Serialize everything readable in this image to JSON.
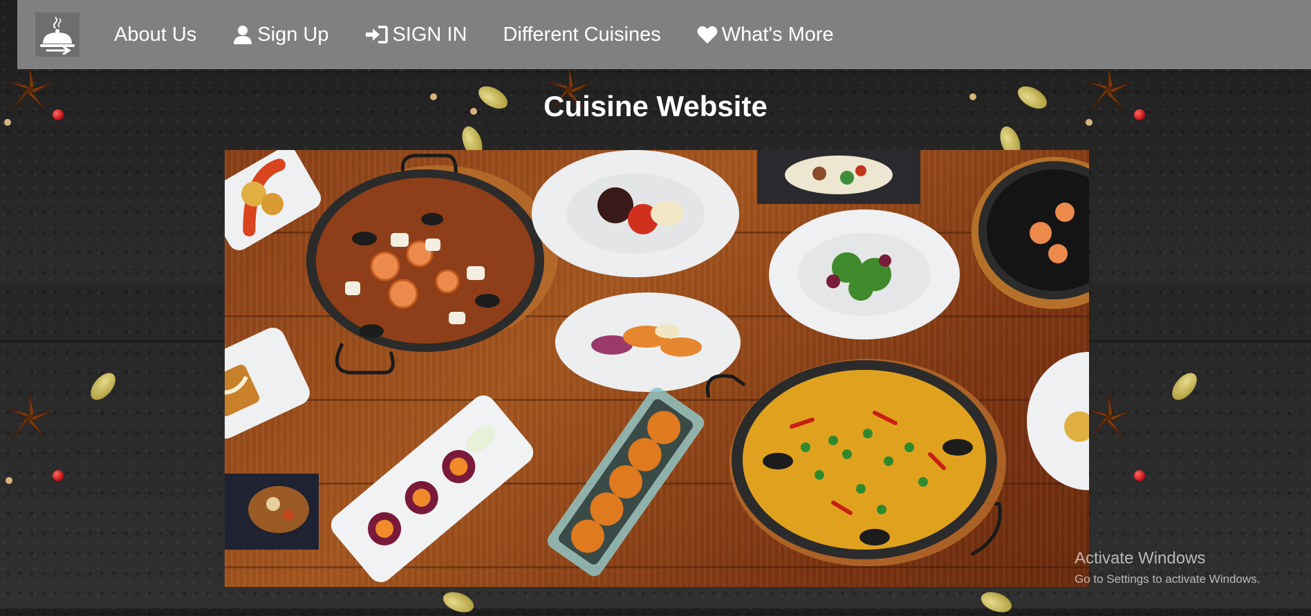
{
  "nav": {
    "logo_icon": "serving-cloche-icon",
    "items": [
      {
        "label": "About Us",
        "icon": ""
      },
      {
        "label": "Sign Up",
        "icon": "user-icon"
      },
      {
        "label": "SIGN IN",
        "icon": "sign-in-icon"
      },
      {
        "label": "Different Cuisines",
        "icon": ""
      },
      {
        "label": "What's More",
        "icon": "heart-icon"
      }
    ]
  },
  "main": {
    "title": "Cuisine Website",
    "hero_image": "food-spread-image"
  },
  "os_watermark": {
    "title": "Activate Windows",
    "subtitle": "Go to Settings to activate Windows."
  },
  "colors": {
    "navbar": "#808080",
    "text": "#ffffff",
    "background": "#262626"
  }
}
